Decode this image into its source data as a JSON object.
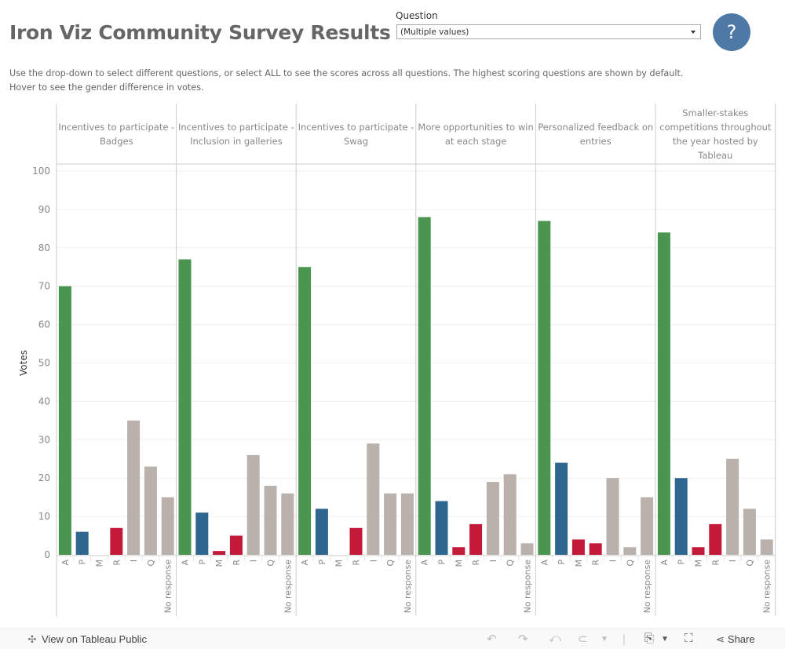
{
  "header": {
    "title": "Iron Viz Community Survey Results",
    "question_label": "Question",
    "question_value": "(Multiple values)",
    "help_label": "?"
  },
  "description": {
    "line1": "Use the drop-down to select different questions, or select ALL to see the scores across all questions. The highest scoring questions are shown by default.",
    "line2": "Hover to see the gender difference in votes."
  },
  "colors": {
    "A": "#4a9650",
    "P": "#2e6690",
    "M": "#c41a3a",
    "R": "#c41a3a",
    "I": "#bab0ac",
    "Q": "#bab0ac",
    "No response": "#bab0ac",
    "help_button": "#4e79a7"
  },
  "chart_data": {
    "type": "bar",
    "ylabel": "Votes",
    "xlabel": "",
    "ylim": [
      0,
      100
    ],
    "yticks": [
      0,
      10,
      20,
      30,
      40,
      50,
      60,
      70,
      80,
      90,
      100
    ],
    "grid": true,
    "categories": [
      "A",
      "P",
      "M",
      "R",
      "I",
      "Q",
      "No response"
    ],
    "panels": [
      {
        "title_lines": [
          "Incentives to participate -",
          "Badges"
        ],
        "values": [
          70,
          6,
          0,
          7,
          35,
          23,
          15
        ]
      },
      {
        "title_lines": [
          "Incentives to participate -",
          "Inclusion in galleries"
        ],
        "values": [
          77,
          11,
          1,
          5,
          26,
          18,
          16
        ]
      },
      {
        "title_lines": [
          "Incentives to participate -",
          "Swag"
        ],
        "values": [
          75,
          12,
          0,
          7,
          29,
          16,
          16
        ]
      },
      {
        "title_lines": [
          "More opportunities to win",
          "at each stage"
        ],
        "values": [
          88,
          14,
          2,
          8,
          19,
          21,
          3
        ]
      },
      {
        "title_lines": [
          "Personalized feedback on",
          "entries"
        ],
        "values": [
          87,
          24,
          4,
          3,
          20,
          2,
          15
        ]
      },
      {
        "title_lines": [
          "Smaller-stakes",
          "competitions throughout",
          "the year hosted by",
          "Tableau"
        ],
        "values": [
          84,
          20,
          2,
          8,
          25,
          12,
          4
        ]
      }
    ]
  },
  "footer": {
    "view_label": "View on Tableau Public",
    "share_label": "Share",
    "icons": [
      "tableau-logo-icon",
      "undo-icon",
      "redo-icon",
      "revert-icon",
      "refresh-icon",
      "download-icon",
      "fullscreen-icon",
      "share-icon"
    ]
  }
}
